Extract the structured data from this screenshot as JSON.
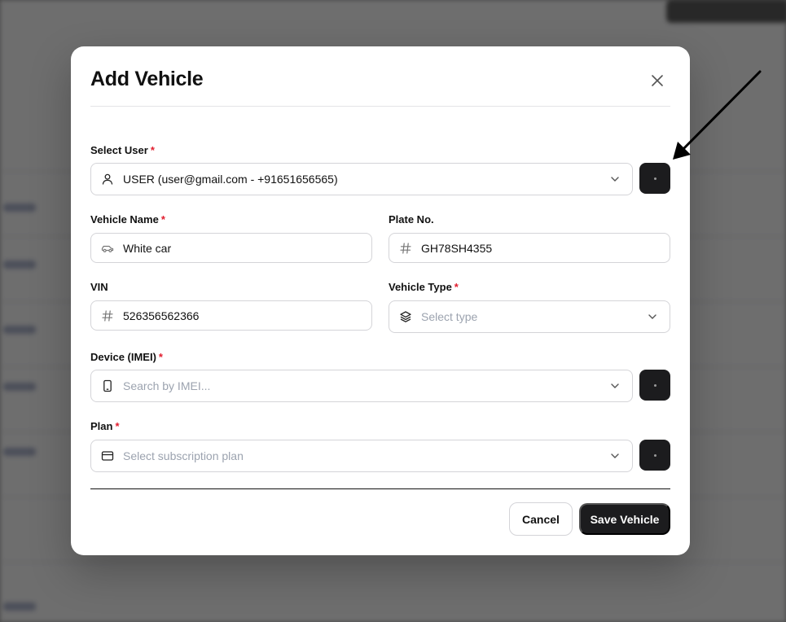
{
  "modal": {
    "title": "Add Vehicle"
  },
  "fields": {
    "user": {
      "label": "Select User",
      "required": "*",
      "value": "USER (user@gmail.com - +91651656565)"
    },
    "vehicle_name": {
      "label": "Vehicle Name",
      "required": "*",
      "value": "White car"
    },
    "plate": {
      "label": "Plate No.",
      "value": "GH78SH4355"
    },
    "vin": {
      "label": "VIN",
      "value": "526356562366"
    },
    "vehicle_type": {
      "label": "Vehicle Type",
      "required": "*",
      "placeholder": "Select type"
    },
    "device": {
      "label": "Device (IMEI)",
      "required": "*",
      "placeholder": "Search by IMEI..."
    },
    "plan": {
      "label": "Plan",
      "required": "*",
      "placeholder": "Select subscription plan"
    }
  },
  "footer": {
    "cancel_label": "Cancel",
    "save_label": "Save Vehicle"
  },
  "icons": {
    "user": "user-icon",
    "car": "car-icon",
    "hash": "hash-icon",
    "layers": "layers-icon",
    "phone": "smartphone-icon",
    "card": "credit-card-icon",
    "chevron": "chevron-down-icon",
    "close": "close-icon"
  },
  "colors": {
    "required": "#e11d2e",
    "primary_dark": "#1c1c1e",
    "border": "#d4d4d8",
    "placeholder": "#9ca3af"
  }
}
